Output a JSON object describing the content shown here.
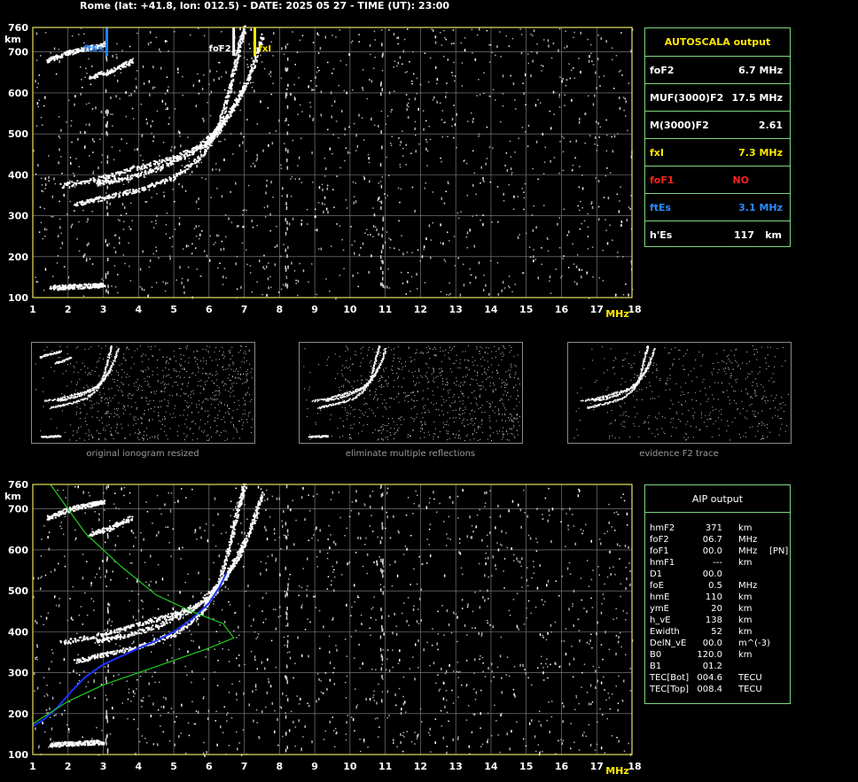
{
  "header": {
    "title": "Rome (lat: +41.8, lon: 012.5) - DATE: 2025 05 27 - TIME (UT): 23:00"
  },
  "colors": {
    "axis": "#e8e060",
    "grid": "#8a8a8a",
    "panel_border": "#7fd67f",
    "fes_marker": "#1e7fff",
    "fof2_marker": "#ffffff",
    "fxi_marker": "#ffe800",
    "profile_blue": "#1a33ff",
    "profile_green": "#22cc22"
  },
  "chart_data": [
    {
      "type": "scatter",
      "name": "autoscala-ionogram",
      "xlabel": "MHz",
      "ylabel": "km",
      "xlim": [
        1,
        18
      ],
      "ylim": [
        100,
        760
      ],
      "x_ticks": [
        1,
        2,
        3,
        4,
        5,
        6,
        7,
        8,
        9,
        10,
        11,
        12,
        13,
        14,
        15,
        16,
        17,
        18
      ],
      "y_ticks": [
        100,
        200,
        300,
        400,
        500,
        600,
        700,
        760
      ],
      "grid": true,
      "markers": [
        {
          "label": "ftEs",
          "x": 3.1,
          "color": "#1e7fff"
        },
        {
          "label": "foF2",
          "x": 6.7,
          "color": "#ffffff"
        },
        {
          "label": "fxI",
          "x": 7.3,
          "color": "#ffe800"
        }
      ],
      "traces": [
        {
          "name": "O-trace",
          "points": [
            [
              2.2,
              330
            ],
            [
              3,
              345
            ],
            [
              4,
              365
            ],
            [
              5,
              395
            ],
            [
              5.8,
              450
            ],
            [
              6.3,
              530
            ],
            [
              6.6,
              620
            ],
            [
              6.8,
              700
            ],
            [
              7.0,
              760
            ]
          ]
        },
        {
          "name": "X-trace",
          "points": [
            [
              2.8,
              380
            ],
            [
              3.5,
              390
            ],
            [
              4.5,
              415
            ],
            [
              5.5,
              455
            ],
            [
              6.2,
              510
            ],
            [
              6.8,
              580
            ],
            [
              7.2,
              660
            ],
            [
              7.5,
              740
            ]
          ]
        },
        {
          "name": "O-multiple",
          "points": [
            [
              1.8,
              375
            ],
            [
              3,
              395
            ],
            [
              4,
              420
            ],
            [
              5,
              445
            ],
            [
              6,
              480
            ],
            [
              6.5,
              540
            ],
            [
              7,
              620
            ]
          ]
        },
        {
          "name": "Es-trace",
          "points": [
            [
              1.5,
              125
            ],
            [
              2,
              128
            ],
            [
              2.5,
              130
            ],
            [
              3,
              132
            ]
          ]
        },
        {
          "name": "2nd-hop-1",
          "points": [
            [
              1.4,
              680
            ],
            [
              2,
              700
            ],
            [
              2.6,
              712
            ],
            [
              3.0,
              720
            ]
          ]
        },
        {
          "name": "2nd-hop-2",
          "points": [
            [
              2.6,
              640
            ],
            [
              3.2,
              655
            ],
            [
              3.8,
              680
            ]
          ]
        }
      ]
    },
    {
      "type": "scatter",
      "name": "aip-ionogram",
      "xlabel": "MHz",
      "ylabel": "km",
      "xlim": [
        1,
        18
      ],
      "ylim": [
        100,
        760
      ],
      "x_ticks": [
        1,
        2,
        3,
        4,
        5,
        6,
        7,
        8,
        9,
        10,
        11,
        12,
        13,
        14,
        15,
        16,
        17,
        18
      ],
      "y_ticks": [
        100,
        200,
        300,
        400,
        500,
        600,
        700,
        760
      ],
      "grid": true,
      "traces": [
        {
          "name": "O-trace",
          "points": [
            [
              2.2,
              330
            ],
            [
              3,
              345
            ],
            [
              4,
              365
            ],
            [
              5,
              395
            ],
            [
              5.8,
              450
            ],
            [
              6.3,
              530
            ],
            [
              6.6,
              620
            ],
            [
              6.8,
              700
            ],
            [
              7.0,
              760
            ]
          ]
        },
        {
          "name": "X-trace",
          "points": [
            [
              2.8,
              380
            ],
            [
              3.5,
              390
            ],
            [
              4.5,
              415
            ],
            [
              5.5,
              455
            ],
            [
              6.2,
              510
            ],
            [
              6.8,
              580
            ],
            [
              7.2,
              660
            ],
            [
              7.5,
              740
            ]
          ]
        },
        {
          "name": "O-multiple",
          "points": [
            [
              1.8,
              375
            ],
            [
              3,
              395
            ],
            [
              4,
              420
            ],
            [
              5,
              445
            ],
            [
              6,
              480
            ],
            [
              6.5,
              540
            ],
            [
              7,
              620
            ]
          ]
        },
        {
          "name": "Es-trace",
          "points": [
            [
              1.5,
              125
            ],
            [
              2,
              128
            ],
            [
              2.5,
              130
            ],
            [
              3,
              132
            ]
          ]
        },
        {
          "name": "2nd-hop-1",
          "points": [
            [
              1.4,
              680
            ],
            [
              2,
              700
            ],
            [
              2.6,
              712
            ],
            [
              3.0,
              720
            ]
          ]
        },
        {
          "name": "2nd-hop-2",
          "points": [
            [
              2.6,
              640
            ],
            [
              3.2,
              655
            ],
            [
              3.8,
              680
            ]
          ]
        }
      ],
      "profiles": [
        {
          "name": "true-height-profile",
          "color": "#1a33ff",
          "points": [
            [
              1.0,
              170
            ],
            [
              1.3,
              185
            ],
            [
              1.7,
              215
            ],
            [
              2.1,
              255
            ],
            [
              2.5,
              290
            ],
            [
              3.0,
              320
            ],
            [
              3.5,
              340
            ],
            [
              4.0,
              360
            ],
            [
              4.5,
              378
            ],
            [
              5.0,
              400
            ],
            [
              5.5,
              430
            ],
            [
              6.0,
              470
            ],
            [
              6.3,
              510
            ],
            [
              6.5,
              545
            ]
          ]
        },
        {
          "name": "model-profile",
          "color": "#22cc22",
          "points": [
            [
              1.0,
              175
            ],
            [
              2.0,
              230
            ],
            [
              3.0,
              270
            ],
            [
              4.0,
              300
            ],
            [
              5.0,
              330
            ],
            [
              6.0,
              360
            ],
            [
              6.7,
              385
            ],
            [
              6.4,
              420
            ],
            [
              5.5,
              450
            ],
            [
              4.5,
              490
            ],
            [
              3.5,
              560
            ],
            [
              2.5,
              640
            ],
            [
              1.5,
              760
            ]
          ]
        }
      ]
    }
  ],
  "autoscala": {
    "title": "AUTOSCALA output",
    "rows": [
      {
        "key": "foF2",
        "value": "6.7 MHz",
        "color": "#ffffff"
      },
      {
        "key": "MUF(3000)F2",
        "value": "17.5 MHz",
        "color": "#ffffff"
      },
      {
        "key": "M(3000)F2",
        "value": "2.61",
        "color": "#ffffff"
      },
      {
        "key": "fxI",
        "value": "7.3 MHz",
        "color": "#ffe800"
      },
      {
        "key": "foF1",
        "value": "NO",
        "color": "#ff2020"
      },
      {
        "key": "ftEs",
        "value": "3.1 MHz",
        "color": "#2a8cff"
      },
      {
        "key": "h'Es",
        "value": "117",
        "unit": "km",
        "color": "#ffffff"
      }
    ]
  },
  "thumbnails": [
    {
      "caption": "original ionogram resized"
    },
    {
      "caption": "eliminate multiple reflections"
    },
    {
      "caption": "evidence F2 trace"
    }
  ],
  "aip": {
    "title": "AIP output",
    "rows": [
      {
        "key": "hmF2",
        "value": "371",
        "unit": "km",
        "extra": ""
      },
      {
        "key": "foF2",
        "value": "06.7",
        "unit": "MHz",
        "extra": ""
      },
      {
        "key": "foF1",
        "value": "00.0",
        "unit": "MHz",
        "extra": "[PN]"
      },
      {
        "key": "hmF1",
        "value": "---",
        "unit": "km",
        "extra": ""
      },
      {
        "key": "D1",
        "value": "00.0",
        "unit": "",
        "extra": ""
      },
      {
        "key": "foE",
        "value": "0.5",
        "unit": "MHz",
        "extra": ""
      },
      {
        "key": "hmE",
        "value": "110",
        "unit": "km",
        "extra": ""
      },
      {
        "key": "ymE",
        "value": "20",
        "unit": "km",
        "extra": ""
      },
      {
        "key": "h_vE",
        "value": "138",
        "unit": "km",
        "extra": ""
      },
      {
        "key": "Ewidth",
        "value": "52",
        "unit": "km",
        "extra": ""
      },
      {
        "key": "DelN_vE",
        "value": "00.0",
        "unit": "m^(-3)",
        "extra": ""
      },
      {
        "key": "B0",
        "value": "120.0",
        "unit": "km",
        "extra": ""
      },
      {
        "key": "B1",
        "value": "01.2",
        "unit": "",
        "extra": ""
      },
      {
        "key": "TEC[Bot]",
        "value": "004.6",
        "unit": "TECU",
        "extra": ""
      },
      {
        "key": "TEC[Top]",
        "value": "008.4",
        "unit": "TECU",
        "extra": ""
      }
    ]
  }
}
